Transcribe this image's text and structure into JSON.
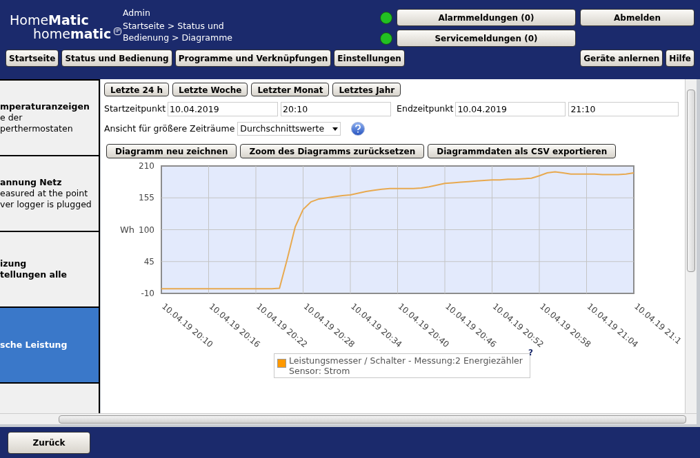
{
  "header": {
    "logo_top": "Home**Matic**",
    "logo_bottom": "home**matic**",
    "logo_badge": "IP",
    "user": "Admin",
    "breadcrumb": "Startseite > Status und Bedienung > Diagramme",
    "alerts": [
      {
        "label": "Alarmmeldungen (0)",
        "color": "#22c022"
      },
      {
        "label": "Servicemeldungen (0)",
        "color": "#22c022"
      }
    ],
    "logout": "Abmelden",
    "nav": [
      {
        "label": "Startseite"
      },
      {
        "label": "Status und Bedienung"
      },
      {
        "label": "Programme und Verknüpfungen"
      },
      {
        "label": "Einstellungen"
      }
    ],
    "nav_right": [
      {
        "label": "Geräte anlernen"
      },
      {
        "label": "Hilfe"
      }
    ]
  },
  "sidebar": {
    "items": [
      {
        "title_lines": [
          "mperaturanzeigen"
        ],
        "description_lines": [
          "e der",
          "perthermostaten"
        ],
        "selected": false
      },
      {
        "title_lines": [
          "annung Netz"
        ],
        "description_lines": [
          "easured at the point",
          "ver logger is plugged"
        ],
        "selected": false
      },
      {
        "title_lines": [
          "izung",
          "tellungen alle"
        ],
        "selected": false
      },
      {
        "title_lines": [
          "sche Leistung"
        ],
        "selected": true
      },
      {
        "selected": false
      }
    ]
  },
  "range_buttons": [
    "Letzte 24 h",
    "Letzte Woche",
    "Letzter Monat",
    "Letztes Jahr"
  ],
  "start": {
    "label": "Startzeitpunkt",
    "date": "10.04.2019",
    "time": "20:10"
  },
  "end": {
    "label": "Endzeitpunkt",
    "date": "10.04.2019",
    "time": "21:10"
  },
  "view": {
    "label": "Ansicht für größere Zeiträume",
    "value": "Durchschnittswerte"
  },
  "actions": [
    "Diagramm neu zeichnen",
    "Zoom des Diagramms zurücksetzen",
    "Diagrammdaten als CSV exportieren"
  ],
  "chart": {
    "help_mark": "?",
    "chart_data": {
      "type": "line",
      "ylabel": "Wh",
      "grid": true,
      "categories": [
        "10.04.19 20:10",
        null,
        null,
        null,
        null,
        null,
        "10.04.19 20:16",
        null,
        null,
        null,
        null,
        null,
        "10.04.19 20:22",
        null,
        null,
        null,
        null,
        null,
        "10.04.19 20:28",
        null,
        null,
        null,
        null,
        null,
        "10.04.19 20:34",
        null,
        null,
        null,
        null,
        null,
        "10.04.19 20:40",
        null,
        null,
        null,
        null,
        null,
        "10.04.19 20:46",
        null,
        null,
        null,
        null,
        null,
        "10.04.19 20:52",
        null,
        null,
        null,
        null,
        null,
        "10.04.19 20:58",
        null,
        null,
        null,
        null,
        null,
        "10.04.19 21:04",
        null,
        null,
        null,
        null,
        null,
        "10.04.19 21:1"
      ],
      "series": [
        {
          "name": "Leistungsmesser / Schalter - Messung:2 Energiezähler\nSensor: Strom",
          "color": "#e8a94f",
          "values": [
            -2,
            -2,
            -2,
            -2,
            -2,
            -2,
            -2,
            -2,
            -2,
            -2,
            -2,
            -2,
            -2,
            -2,
            -2,
            -1,
            50,
            105,
            135,
            148,
            153,
            155,
            157,
            159,
            160,
            163,
            166,
            168,
            170,
            171,
            171,
            171,
            171,
            172,
            174,
            177,
            180,
            181,
            182,
            183,
            184,
            185,
            186,
            186,
            187,
            187,
            188,
            189,
            193,
            198,
            200,
            198,
            196,
            196,
            196,
            196,
            195,
            195,
            195,
            196,
            198
          ]
        }
      ],
      "ylim": [
        -10,
        210
      ],
      "yticks": [
        -10,
        45,
        100,
        155,
        210
      ]
    }
  },
  "footer": {
    "back": "Zurück"
  }
}
